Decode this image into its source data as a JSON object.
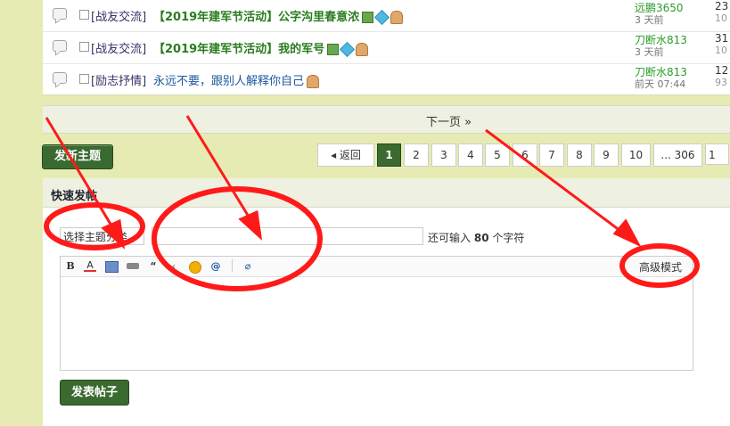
{
  "threads": [
    {
      "category": "[战友交流]",
      "title": "【2019年建军节活动】公字沟里春意浓",
      "style": "bold",
      "author": "远鹏3650",
      "time": "3 天前",
      "count1": "23",
      "count2": "10"
    },
    {
      "category": "[战友交流]",
      "title": "【2019年建军节活动】我的军号",
      "style": "bold",
      "author": "刀断水813",
      "time": "3 天前",
      "count1": "31",
      "count2": "10"
    },
    {
      "category": "[励志抒情]",
      "title": "永远不要，跟别人解释你自己",
      "style": "plain",
      "author": "刀断水813",
      "time": "前天 07:44",
      "count1": "12",
      "count2": "93"
    }
  ],
  "next_page": "下一页 »",
  "new_thread_label": "发新主题",
  "pager": {
    "back": "返回",
    "pages": [
      "1",
      "2",
      "3",
      "4",
      "5",
      "6",
      "7",
      "8",
      "9",
      "10",
      "... 306",
      "1"
    ],
    "current": "1"
  },
  "quick_reply": {
    "title": "快速发帖",
    "type_select": "选择主题分类",
    "remain_prefix": "还可输入",
    "remain_count": "80",
    "remain_suffix": "个字符",
    "toolbar": [
      "B",
      "A",
      "img",
      "link",
      "quote",
      "emoji",
      "at",
      "attach"
    ],
    "advanced_mode": "高级模式",
    "submit": "发表帖子"
  },
  "colors": {
    "accent": "#3b6a30",
    "annotation": "#ff0000",
    "link_green": "#2a7c1f"
  }
}
